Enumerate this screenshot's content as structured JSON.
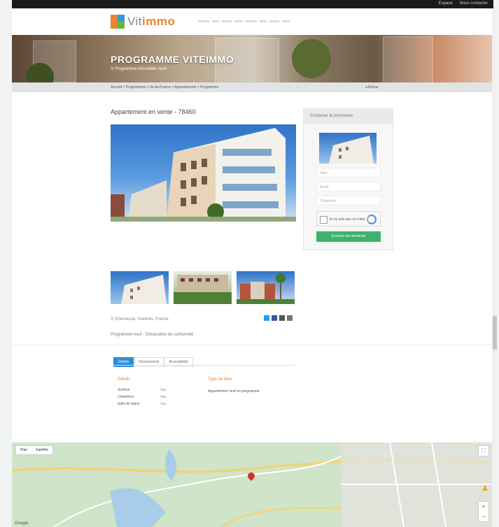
{
  "topbar": {
    "links": [
      "Espace",
      "Nous contacter"
    ]
  },
  "header": {
    "logo_prefix": "Vit",
    "logo_suffix": "immo",
    "nav": [
      "",
      "",
      "",
      "",
      "",
      "",
      "",
      ""
    ]
  },
  "hero": {
    "title": "PROGRAMME VITEIMMO",
    "subtitle": "Programme immobilier neuf"
  },
  "breadcrumb": {
    "trail": "Accueil > Programmes > Ile-de-France > Appartements > Programme",
    "back": "Retour"
  },
  "listing": {
    "title": "Appartement en vente - 78460",
    "address": "Chevreuse, Yvelines, France",
    "description": "Programme neuf - Déclaration de conformité"
  },
  "contact": {
    "heading": "Contacter le promoteur",
    "fields": [
      "Nom",
      "Email",
      "Téléphone"
    ],
    "captcha_label": "Je ne suis pas un robot",
    "submit": "Envoyer ma demande"
  },
  "tabs": [
    "Détails",
    "Financement",
    "Accessibilité"
  ],
  "details": {
    "features_heading": "Détails",
    "features": [
      {
        "label": "Surface",
        "value": "n.c."
      },
      {
        "label": "Chambres",
        "value": "n.c."
      },
      {
        "label": "Salle de bains",
        "value": "n.c."
      }
    ],
    "type_heading": "Type de bien",
    "type_value": "Appartement neuf en programme"
  },
  "map": {
    "controls": [
      "Plan",
      "Satellite"
    ],
    "attribution": "Google"
  },
  "colors": {
    "accent": "#e9862b",
    "primary": "#2b8fd6",
    "submit": "#3cb36b"
  }
}
